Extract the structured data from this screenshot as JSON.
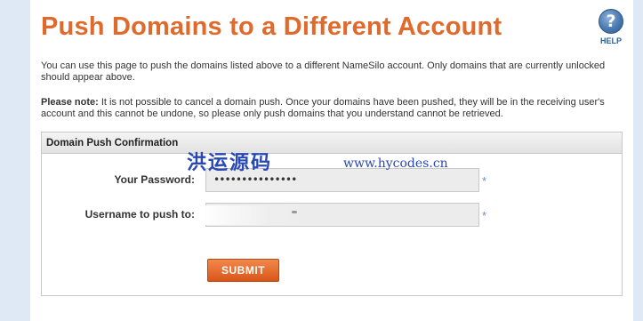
{
  "page": {
    "title": "Push Domains to a Different Account",
    "help_label": "HELP",
    "help_glyph": "?",
    "intro": "You can use this page to push the domains listed above to a different NameSilo account. Only domains that are currently unlocked should appear above.",
    "note_label": "Please note:",
    "note_text": " It is not possible to cancel a domain push. Once your domains have been pushed, they will be in the receiving user's account and this cannot be undone, so please only push domains that you understand cannot be retrieved."
  },
  "panel": {
    "header": "Domain Push Confirmation",
    "password_label": "Your Password:",
    "password_value": "•••••••••••••••",
    "username_label": "Username to push to:",
    "required_marker": "*",
    "submit_label": "SUBMIT"
  },
  "watermark": {
    "cn_text": "洪运源码",
    "url": "www.hycodes.cn"
  },
  "colors": {
    "title": "#e06a2c",
    "submit": "#e0641f",
    "watermark": "#2948b3",
    "background_strip": "#dfe8f5"
  },
  "icons": {
    "help": "question-mark-circle-icon"
  }
}
